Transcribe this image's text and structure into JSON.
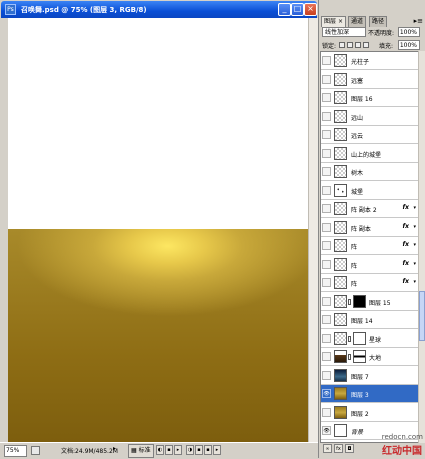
{
  "document_window": {
    "title": "召唤舞.psd @ 75% (图层 3, RGB/8)",
    "ps_icon_label": "Ps",
    "controls": {
      "minimize": "_",
      "maximize": "□",
      "close": "×"
    },
    "statusbar": {
      "zoom": "75%",
      "doc_info": "文档:24.9M/485.2M",
      "standard_label": "标准"
    }
  },
  "layers_panel": {
    "tabs": [
      "图层",
      "通道",
      "路径"
    ],
    "tab_close": "×",
    "menu_glyph": "▸≡",
    "blend_mode": "线性加深",
    "opacity_label": "不透明度:",
    "opacity_value": "100%",
    "lock_label": "锁定:",
    "fill_label": "填充:",
    "fill_value": "100%",
    "layers": [
      {
        "name": "光柱子",
        "thumb": "transparent",
        "visible": false,
        "fx": false
      },
      {
        "name": "远塞",
        "thumb": "transparent",
        "visible": false,
        "fx": false
      },
      {
        "name": "图层 16",
        "thumb": "transparent",
        "visible": false,
        "fx": false
      },
      {
        "name": "远山",
        "thumb": "transparent",
        "visible": false,
        "fx": false
      },
      {
        "name": "远云",
        "thumb": "transparent",
        "visible": false,
        "fx": false
      },
      {
        "name": "山上的城堡",
        "thumb": "transparent",
        "visible": false,
        "fx": false
      },
      {
        "name": "树木",
        "thumb": "transparent",
        "visible": false,
        "fx": false
      },
      {
        "name": "城堡",
        "thumb": "dots",
        "visible": false,
        "fx": false
      },
      {
        "name": "阵 副本 2",
        "thumb": "transparent",
        "visible": false,
        "fx": true
      },
      {
        "name": "阵 副本",
        "thumb": "transparent",
        "visible": false,
        "fx": true
      },
      {
        "name": "阵",
        "thumb": "transparent",
        "visible": false,
        "fx": true
      },
      {
        "name": "阵",
        "thumb": "transparent",
        "visible": false,
        "fx": true
      },
      {
        "name": "阵",
        "thumb": "transparent",
        "visible": false,
        "fx": true
      },
      {
        "name": "图层 15",
        "thumb": "transparent",
        "visible": false,
        "fx": false,
        "mask": "black"
      },
      {
        "name": "图层 14",
        "thumb": "transparent",
        "visible": false,
        "fx": false
      },
      {
        "name": "星球",
        "thumb": "transparent",
        "visible": false,
        "fx": false,
        "mask": "white"
      },
      {
        "name": "大地",
        "thumb": "earth",
        "visible": false,
        "fx": false,
        "mask": "band"
      },
      {
        "name": "图层 7",
        "thumb": "dark",
        "visible": false,
        "fx": false
      },
      {
        "name": "图层 3",
        "thumb": "gold",
        "visible": true,
        "fx": false,
        "selected": true
      },
      {
        "name": "图层 2",
        "thumb": "gold",
        "visible": false,
        "fx": false
      },
      {
        "name": "背景",
        "thumb": "white",
        "visible": true,
        "fx": false,
        "italic": true
      }
    ],
    "icons": {
      "eye": "eye-icon",
      "fx": "fx",
      "fx_arrow": "▾"
    },
    "bottom_buttons": [
      "link",
      "fx",
      "mask",
      "adjustment",
      "group",
      "new-layer",
      "delete"
    ]
  },
  "watermark": {
    "url": "redocn.com",
    "text": "红动中国"
  }
}
